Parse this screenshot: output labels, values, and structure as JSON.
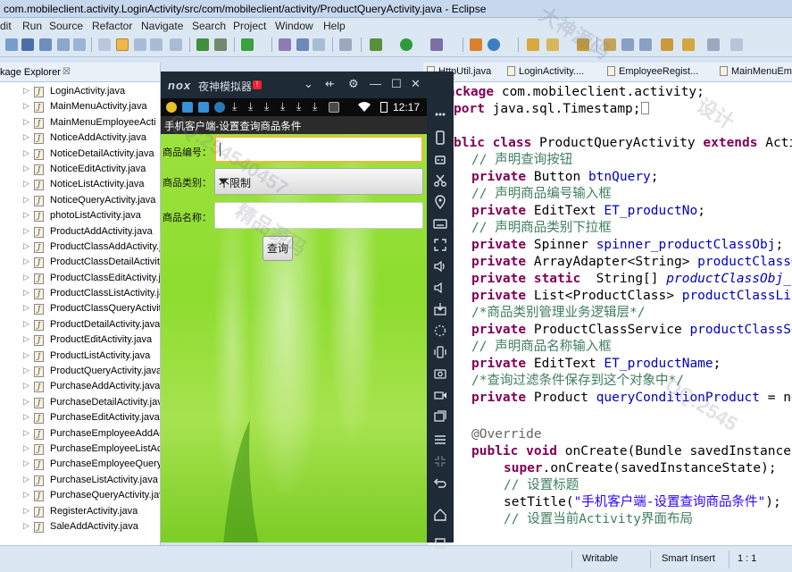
{
  "window": {
    "title": "com.mobileclient.activity.LoginActivity/src/com/mobileclient/activity/ProductQueryActivity.java - Eclipse"
  },
  "menu": [
    "dit",
    "Run",
    "Source",
    "Refactor",
    "Navigate",
    "Search",
    "Project",
    "Window",
    "Help"
  ],
  "package_explorer": {
    "tab_label": "kage Explorer",
    "close_glyph": "☒",
    "files": [
      "LoginActivity.java",
      "MainMenuActivity.java",
      "MainMenuEmployeeActi",
      "NoticeAddActivity.java",
      "NoticeDetailActivity.java",
      "NoticeEditActivity.java",
      "NoticeListActivity.java",
      "NoticeQueryActivity.java",
      "photoListActivity.java",
      "ProductAddActivity.java",
      "ProductClassAddActivity.j",
      "ProductClassDetailActivity",
      "ProductClassEditActivity.j",
      "ProductClassListActivity.ja",
      "ProductClassQueryActivit",
      "ProductDetailActivity.java",
      "ProductEditActivity.java",
      "ProductListActivity.java",
      "ProductQueryActivity.java",
      "PurchaseAddActivity.java",
      "PurchaseDetailActivity.java",
      "PurchaseEditActivity.java",
      "PurchaseEmployeeAddAc",
      "PurchaseEmployeeListAct",
      "PurchaseEmployeeQuery",
      "PurchaseListActivity.java",
      "PurchaseQueryActivity.jav",
      "RegisterActivity.java",
      "SaleAddActivity.java"
    ]
  },
  "editor_tabs": [
    "HttpUtil.java",
    "LoginActivity....",
    "EmployeeRegist...",
    "MainMenuEm"
  ],
  "code": {
    "l1_kw": "package",
    "l1_rest": " com.mobileclient.activity;",
    "l2_kw": "port",
    "l2_rest": " java.sql.Timestamp;",
    "l3_kw1": "blic class",
    "l3_mid": " ProductQueryActivity ",
    "l3_kw2": "extends",
    "l3_tail": " Acti",
    "c1": "// 声明查询按钮",
    "l5_kw": "private",
    "l5_type": " Button ",
    "l5_fld": "btnQuery",
    "l5_end": ";",
    "c2": "// 声明商品编号输入框",
    "l7_kw": "private",
    "l7_type": " EditText ",
    "l7_fld": "ET_productNo",
    "l7_end": ";",
    "c3": "// 声明商品类别下拉框",
    "l9_kw": "private",
    "l9_type": " Spinner ",
    "l9_fld": "spinner_productClassObj",
    "l9_end": ";",
    "l10_kw": "private",
    "l10_type": " ArrayAdapter<String> ",
    "l10_fld": "productClassO",
    "l11_kw1": "private",
    "l11_kw2": " static",
    "l11_type": "  String[] ",
    "l11_fld": "productClassObj_",
    "l12_kw": "private",
    "l12_type": " List<ProductClass> ",
    "l12_fld": "productClassLis",
    "c4": "/*商品类别管理业务逻辑层*/",
    "l14_kw": "private",
    "l14_type": " ProductClassService ",
    "l14_fld": "productClassSe",
    "c5": "// 声明商品名称输入框",
    "l16_kw": "private",
    "l16_type": " EditText ",
    "l16_fld": "ET_productName",
    "l16_end": ";",
    "c6": "/*查询过滤条件保存到这个对象中*/",
    "l18_kw": "private",
    "l18_type": " Product ",
    "l18_fld": "queryConditionProduct",
    "l18_end": " = ne",
    "ann": "@Override",
    "l21_kw1": "public",
    "l21_kw2": " void",
    "l21_rest": " onCreate(Bundle savedInstanceS",
    "l22_kw": "super",
    "l22_rest": ".onCreate(savedInstanceState);",
    "c7": "// 设置标题",
    "l24_pre": "setTitle(",
    "l24_str": "\"手机客户端-设置查询商品条件\"",
    "l24_end": ");",
    "c8": "// 设置当前Activity界面布局"
  },
  "status": {
    "writable": "Writable",
    "insert": "Smart Insert",
    "pos": "1 : 1"
  },
  "emulator": {
    "logo": "nox",
    "title": "夜神模拟器",
    "badge": "!",
    "time": "12:17",
    "app_title": "手机客户端-设置查询商品条件",
    "form": {
      "product_no_label": "商品编号：",
      "product_class_label": "商品类别：",
      "product_class_value": "不限制",
      "product_name_label": "商品名称：",
      "query_button": "查询"
    }
  },
  "watermarks": [
    "大神源码",
    "QQ:254540457",
    "精品源码",
    "设计",
    "QQ:2545"
  ],
  "colors": {
    "accent_orange": "#f2b63b",
    "screen_green": "#8edc30",
    "keyword": "#7f0055",
    "comment": "#3f7f5f",
    "field": "#0000c0"
  }
}
